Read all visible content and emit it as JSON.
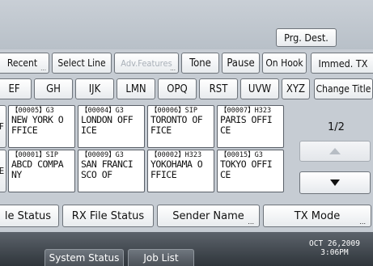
{
  "toolbar": {
    "prg_dest": "Prg. Dest."
  },
  "mode_row": {
    "recent": "Recent",
    "select_line": "Select Line",
    "adv_features": "Adv.Features",
    "tone": "Tone",
    "pause": "Pause",
    "on_hook": "On Hook",
    "immed_tx": "Immed. TX"
  },
  "index_tabs": [
    "EF",
    "GH",
    "IJK",
    "LMN",
    "OPQ",
    "RST",
    "UVW",
    "XYZ"
  ],
  "change_title": "Change Title",
  "destinations": [
    {
      "code": "【00005】G3",
      "line1": "NEW YORK O",
      "line2": "FFICE"
    },
    {
      "code": "【00004】G3",
      "line1": "LONDON OFF",
      "line2": "ICE"
    },
    {
      "code": "【00006】SIP",
      "line1": "TORONTO OF",
      "line2": "FICE"
    },
    {
      "code": "【00007】H323",
      "line1": "PARIS OFFI",
      "line2": "CE"
    },
    {
      "code": "【00001】SIP",
      "line1": "ABCD COMPA",
      "line2": "NY"
    },
    {
      "code": "【00009】G3",
      "line1": "SAN FRANCI",
      "line2": "SCO OF"
    },
    {
      "code": "【00002】H323",
      "line1": "YOKOHAMA O",
      "line2": "FFICE"
    },
    {
      "code": "【00015】G3",
      "line1": "TOKYO OFFI",
      "line2": "CE"
    }
  ],
  "pagination": {
    "page": "1/2"
  },
  "status_tabs": {
    "tx_file_status": "le Status",
    "rx_file_status": "RX File Status",
    "sender_name": "Sender Name",
    "tx_mode": "TX Mode"
  },
  "bottom_bar": {
    "system_status": "System Status",
    "job_list": "Job List",
    "date": "OCT  26,2009",
    "time": "3:06PM"
  },
  "icons": {
    "page_up": "triangle-up-icon",
    "page_down": "triangle-down-icon"
  }
}
